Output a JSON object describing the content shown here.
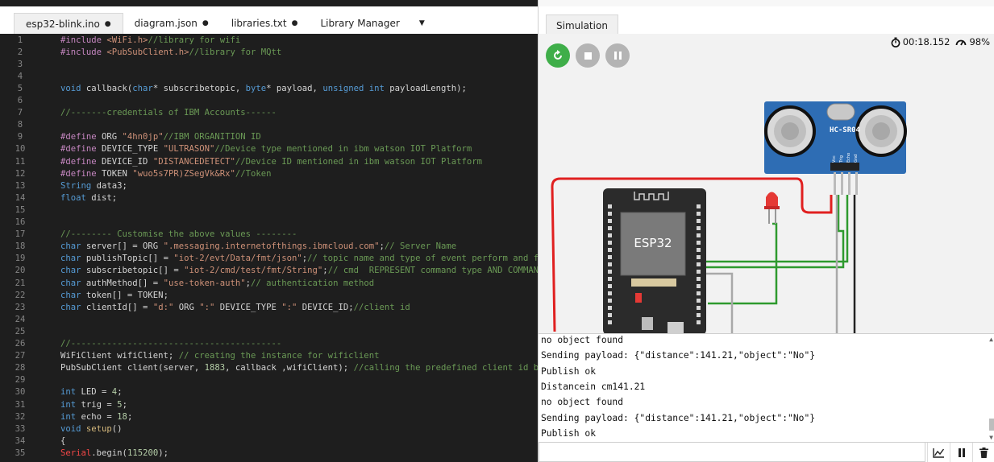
{
  "editor": {
    "tabs": [
      {
        "label": "esp32-blink.ino",
        "modified": "●"
      },
      {
        "label": "diagram.json",
        "modified": "●"
      },
      {
        "label": "libraries.txt",
        "modified": "●"
      },
      {
        "label": "Library Manager",
        "modified": ""
      }
    ],
    "menu_icon": "caret-down-icon"
  },
  "code_lines": [
    {
      "n": "1",
      "h": "<span class='p'>#include</span> <span class='s'>&lt;WiFi.h&gt;</span><span class='c'>//library for wifi</span>"
    },
    {
      "n": "2",
      "h": "<span class='p'>#include</span> <span class='s'>&lt;PubSubClient.h&gt;</span><span class='c'>//library for MQtt</span>"
    },
    {
      "n": "3",
      "h": ""
    },
    {
      "n": "4",
      "h": ""
    },
    {
      "n": "5",
      "h": "<span class='k'>void</span> callback(<span class='k'>char</span>* subscribetopic, <span class='k'>byte</span>* payload, <span class='k'>unsigned int</span> payloadLength);"
    },
    {
      "n": "6",
      "h": ""
    },
    {
      "n": "7",
      "h": "<span class='c'>//-------credentials of IBM Accounts------</span>"
    },
    {
      "n": "8",
      "h": ""
    },
    {
      "n": "9",
      "h": "<span class='p'>#define</span> ORG <span class='s'>\"4hn0jp\"</span><span class='c'>//IBM ORGANITION ID</span>"
    },
    {
      "n": "10",
      "h": "<span class='p'>#define</span> DEVICE_TYPE <span class='s'>\"ULTRASON\"</span><span class='c'>//Device type mentioned in ibm watson IOT Platform</span>"
    },
    {
      "n": "11",
      "h": "<span class='p'>#define</span> DEVICE_ID <span class='s'>\"DISTANCEDETECT\"</span><span class='c'>//Device ID mentioned in ibm watson IOT Platform</span>"
    },
    {
      "n": "12",
      "h": "<span class='p'>#define</span> TOKEN <span class='s'>\"wuo5s7PR)ZSegVk&amp;Rx\"</span><span class='c'>//Token</span>"
    },
    {
      "n": "13",
      "h": "<span class='k'>String</span> data3;"
    },
    {
      "n": "14",
      "h": "<span class='k'>float</span> dist;"
    },
    {
      "n": "15",
      "h": ""
    },
    {
      "n": "16",
      "h": ""
    },
    {
      "n": "17",
      "h": "<span class='c'>//-------- Customise the above values --------</span>"
    },
    {
      "n": "18",
      "h": "<span class='k'>char</span> server[] = ORG <span class='s'>\".messaging.internetofthings.ibmcloud.com\"</span>;<span class='c'>// Server Name</span>"
    },
    {
      "n": "19",
      "h": "<span class='k'>char</span> publishTopic[] = <span class='s'>\"iot-2/evt/Data/fmt/json\"</span>;<span class='c'>// topic name and type of event perform and format in which data to be send</span>"
    },
    {
      "n": "20",
      "h": "<span class='k'>char</span> subscribetopic[] = <span class='s'>\"iot-2/cmd/test/fmt/String\"</span>;<span class='c'>// cmd  REPRESENT command type AND COMMAND IS TEST OF FORMAT STRING</span>"
    },
    {
      "n": "21",
      "h": "<span class='k'>char</span> authMethod[] = <span class='s'>\"use-token-auth\"</span>;<span class='c'>// authentication method</span>"
    },
    {
      "n": "22",
      "h": "<span class='k'>char</span> token[] = TOKEN;"
    },
    {
      "n": "23",
      "h": "<span class='k'>char</span> clientId[] = <span class='s'>\"d:\"</span> ORG <span class='s'>\":\"</span> DEVICE_TYPE <span class='s'>\":\"</span> DEVICE_ID;<span class='c'>//client id</span>"
    },
    {
      "n": "24",
      "h": ""
    },
    {
      "n": "25",
      "h": ""
    },
    {
      "n": "26",
      "h": "<span class='c'>//-----------------------------------------</span>"
    },
    {
      "n": "27",
      "h": "WiFiClient wifiClient; <span class='c'>// creating the instance for wificlient</span>"
    },
    {
      "n": "28",
      "h": "PubSubClient client(server, <span class='n'>1883</span>, callback ,wifiClient); <span class='c'>//calling the predefined client id by passing parameter like server id,portand wificredential</span>"
    },
    {
      "n": "29",
      "h": ""
    },
    {
      "n": "30",
      "h": "<span class='k'>int</span> LED = <span class='n'>4</span>;"
    },
    {
      "n": "31",
      "h": "<span class='k'>int</span> trig = <span class='n'>5</span>;"
    },
    {
      "n": "32",
      "h": "<span class='k'>int</span> echo = <span class='n'>18</span>;"
    },
    {
      "n": "33",
      "h": "<span class='k'>void</span> <span class='o'>setup</span>()"
    },
    {
      "n": "34",
      "h": "{"
    },
    {
      "n": "35",
      "h": "<span class='r'>Serial</span>.begin(<span class='n'>115200</span>);"
    }
  ],
  "simulation": {
    "tab_label": "Simulation",
    "controls": {
      "restart_icon": "restart-icon",
      "stop_icon": "stop-icon",
      "pause_icon": "pause-icon"
    },
    "timer": "00:18.152",
    "speed": "98%",
    "sensor_label": "HC-SR04",
    "sensor_pins": [
      "Vcc",
      "Trig",
      "Echo",
      "Gnd"
    ],
    "board_label": "ESP32",
    "colors": {
      "restart": "#3fae49",
      "board": "#2b2b2b",
      "sensor": "#2e6db4",
      "led": "#e53935",
      "wire_red": "#e02020",
      "wire_green": "#2e9a2e"
    }
  },
  "serial": {
    "lines": [
      "no object found",
      "Sending payload: {\"distance\":141.21,\"object\":\"No\"}",
      "Publish ok",
      "Distancein cm141.21",
      "no object found",
      "Sending payload: {\"distance\":141.21,\"object\":\"No\"}",
      "Publish ok"
    ],
    "input_value": "",
    "tools": [
      "chart-icon",
      "pause-icon",
      "trash-icon"
    ]
  }
}
